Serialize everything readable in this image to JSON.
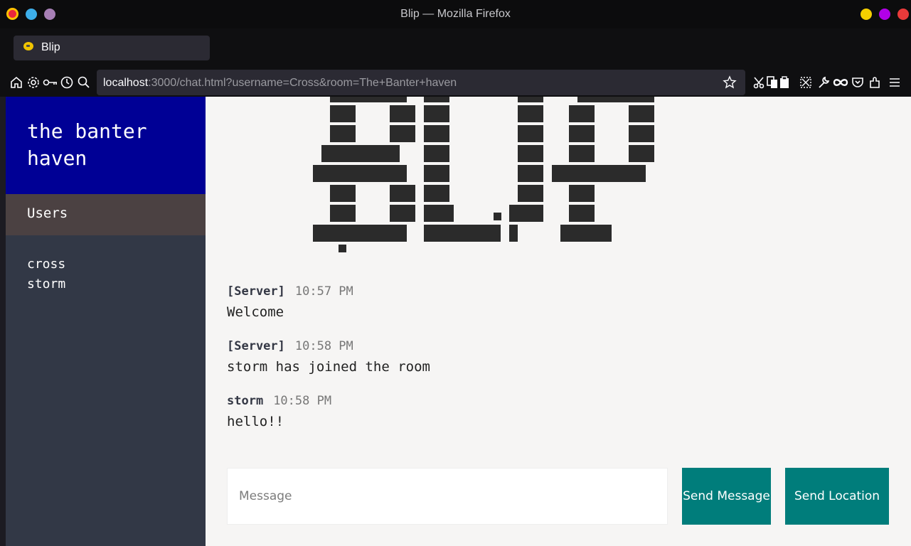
{
  "window": {
    "title": "Blip — Mozilla Firefox"
  },
  "tab": {
    "label": "Blip"
  },
  "urlbar": {
    "host": "localhost",
    "rest": ":3000/chat.html?username=Cross&room=The+Banter+haven"
  },
  "sidebar": {
    "room_title": "the banter haven",
    "users_title": "Users",
    "users": [
      "cross",
      "storm"
    ]
  },
  "messages": [
    {
      "user": "[Server]",
      "time": "10:57 PM",
      "text": "Welcome"
    },
    {
      "user": "[Server]",
      "time": "10:58 PM",
      "text": "storm has joined the room"
    },
    {
      "user": "storm",
      "time": "10:58 PM",
      "text": "hello!!"
    }
  ],
  "composer": {
    "placeholder": "Message",
    "send_label": "Send Message",
    "location_label": "Send Location"
  },
  "colors": {
    "room_header": "#000095",
    "users_header": "#4b4142",
    "sidebar": "#323846",
    "button": "#007d7b"
  }
}
